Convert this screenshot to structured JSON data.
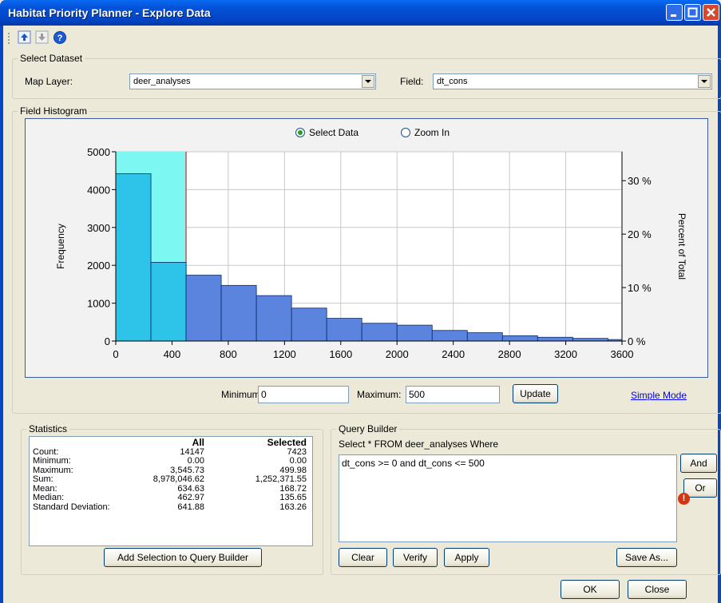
{
  "window": {
    "title": "Habitat Priority Planner - Explore Data"
  },
  "toolbar": {
    "icons": [
      "up-arrow-icon",
      "down-arrow-icon",
      "help-icon"
    ]
  },
  "dataset": {
    "legend": "Select Dataset",
    "map_layer_label": "Map Layer:",
    "map_layer_value": "deer_analyses",
    "field_label": "Field:",
    "field_value": "dt_cons"
  },
  "histogram": {
    "legend": "Field Histogram",
    "mode_select": "Select Data",
    "mode_zoom": "Zoom In",
    "selected_mode": "Select Data",
    "min_label": "Minimum:",
    "min_value": "0",
    "max_label": "Maximum:",
    "max_value": "500",
    "update_label": "Update",
    "simple_mode": "Simple Mode"
  },
  "chart_data": {
    "type": "bar",
    "xlabel": "",
    "ylabel": "Frequency",
    "y2label": "Percent of Total",
    "xlim": [
      0,
      3600
    ],
    "ylim": [
      0,
      5000
    ],
    "x_ticks": [
      "0",
      "400",
      "800",
      "1200",
      "1600",
      "2000",
      "2400",
      "2800",
      "3200",
      "3600"
    ],
    "y_ticks": [
      "0",
      "1000",
      "2000",
      "3000",
      "4000",
      "5000"
    ],
    "y2_ticks": [
      "0 %",
      "10 %",
      "20 %",
      "30 %"
    ],
    "bin_width": 250,
    "bins": [
      0,
      250,
      500,
      750,
      1000,
      1250,
      1500,
      1750,
      2000,
      2250,
      2500,
      2750,
      3000,
      3250,
      3500
    ],
    "values": [
      4420,
      2080,
      1740,
      1470,
      1200,
      870,
      600,
      470,
      420,
      280,
      220,
      140,
      100,
      70,
      40
    ],
    "selection_range": [
      0,
      500
    ],
    "colors": {
      "bars": "#5b84de",
      "selected_bars": "#2ec4ea",
      "selection": "#7df7f2",
      "selection_line": "#e02020"
    },
    "grid": true
  },
  "statistics": {
    "legend": "Statistics",
    "headers": [
      "",
      "All",
      "Selected"
    ],
    "rows": [
      [
        "Count:",
        "14147",
        "7423"
      ],
      [
        "Minimum:",
        "0.00",
        "0.00"
      ],
      [
        "Maximum:",
        "3,545.73",
        "499.98"
      ],
      [
        "Sum:",
        "8,978,046.62",
        "1,252,371.55"
      ],
      [
        "Mean:",
        "634.63",
        "168.72"
      ],
      [
        "Median:",
        "462.97",
        "135.65"
      ],
      [
        "Standard Deviation:",
        "641.88",
        "163.26"
      ]
    ],
    "add_button": "Add Selection to Query Builder"
  },
  "query": {
    "legend": "Query Builder",
    "prefix": "Select * FROM deer_analyses Where",
    "text": "dt_cons >= 0 and dt_cons <= 500",
    "and_label": "And",
    "or_label": "Or",
    "clear_label": "Clear",
    "verify_label": "Verify",
    "apply_label": "Apply",
    "save_as_label": "Save As...",
    "warning": "!"
  },
  "footer": {
    "ok_label": "OK",
    "close_label": "Close"
  }
}
